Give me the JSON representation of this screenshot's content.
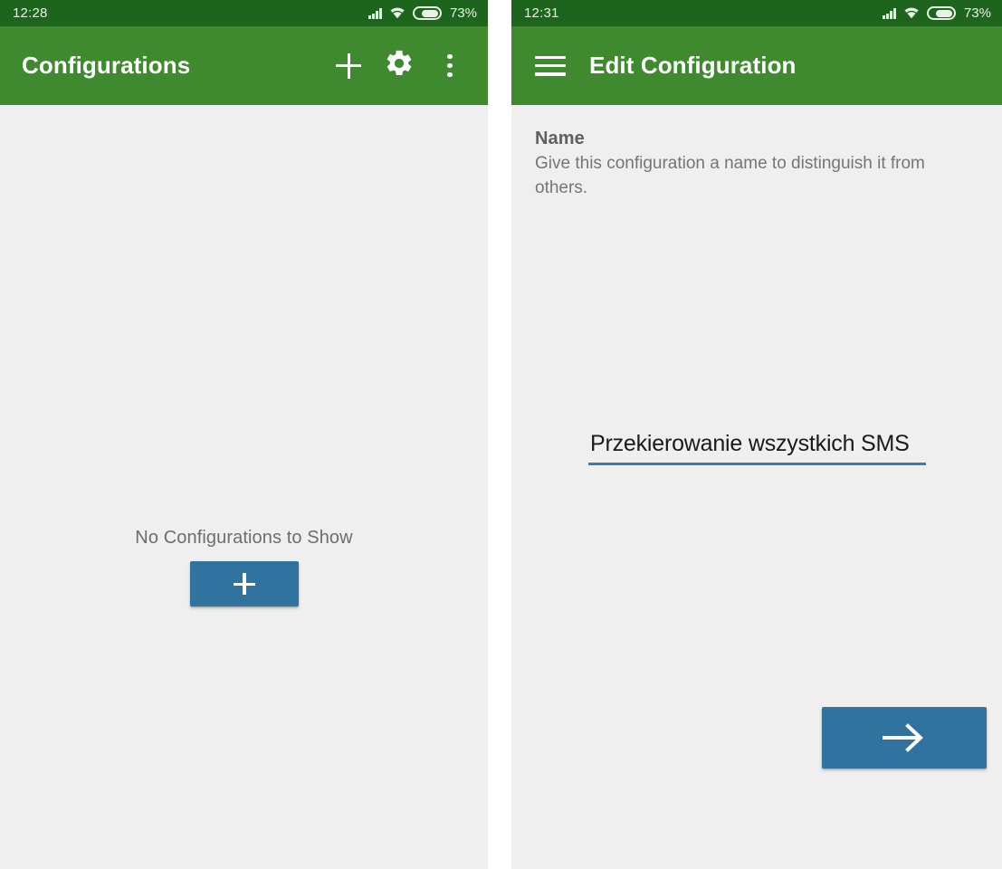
{
  "theme": {
    "status_bar_green": "#1d651d",
    "app_bar_green": "#3f8a2e",
    "accent_blue": "#31739f",
    "underline_blue": "#3a7cb0",
    "page_background": "#efefef"
  },
  "left_screen": {
    "status_bar": {
      "time": "12:28",
      "battery_percent": "73%",
      "signal_icon": "signal-bars-icon",
      "wifi_icon": "wifi-icon",
      "battery_icon": "battery-icon"
    },
    "app_bar": {
      "title": "Configurations",
      "actions": [
        {
          "name": "add-configuration-button",
          "icon": "plus-icon"
        },
        {
          "name": "settings-button",
          "icon": "gear-icon"
        },
        {
          "name": "overflow-menu-button",
          "icon": "more-vertical-icon"
        }
      ]
    },
    "empty_state": {
      "message": "No Configurations to Show",
      "add_button_icon": "plus-icon"
    }
  },
  "right_screen": {
    "status_bar": {
      "time": "12:31",
      "battery_percent": "73%",
      "signal_icon": "signal-bars-icon",
      "wifi_icon": "wifi-icon",
      "battery_icon": "battery-icon"
    },
    "app_bar": {
      "title": "Edit Configuration",
      "navigation_icon": "hamburger-menu-icon"
    },
    "name_section": {
      "title": "Name",
      "description": "Give this configuration a name to distinguish it from others.",
      "input_value": "Przekierowanie wszystkich SMS",
      "input_placeholder": "Name"
    },
    "next_button": {
      "icon": "arrow-right-icon"
    }
  }
}
